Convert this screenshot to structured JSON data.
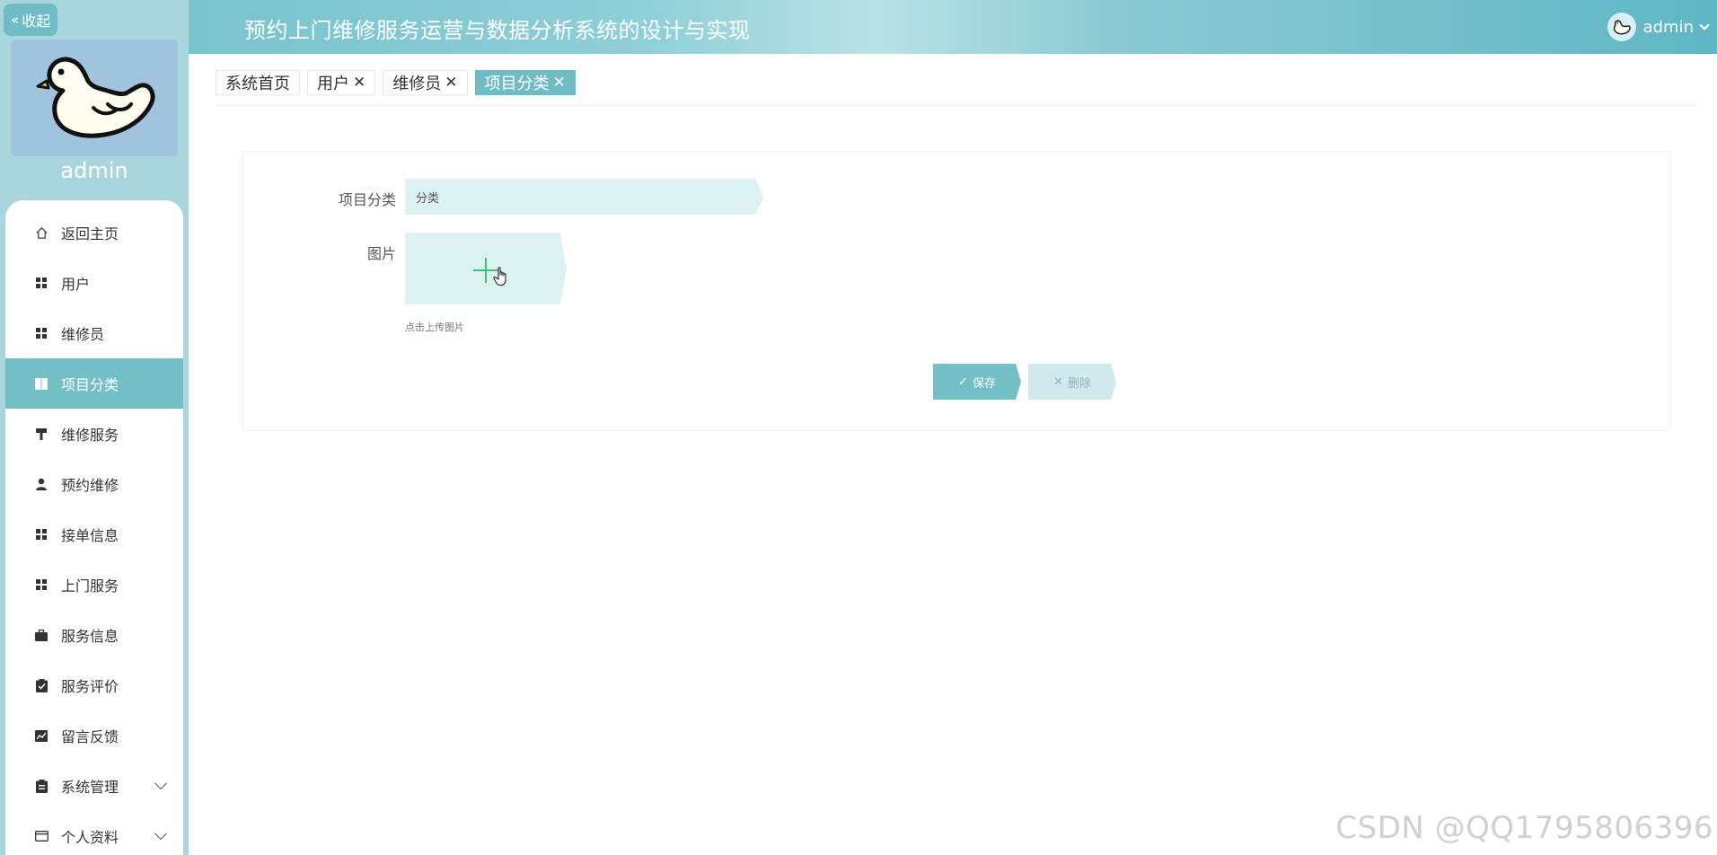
{
  "sidebar": {
    "collapse_label": "收起",
    "username": "admin",
    "items": [
      {
        "label": "返回主页",
        "icon": "home-icon",
        "active": false
      },
      {
        "label": "用户",
        "icon": "grid-icon",
        "active": false
      },
      {
        "label": "维修员",
        "icon": "grid-icon",
        "active": false
      },
      {
        "label": "项目分类",
        "icon": "book-icon",
        "active": true
      },
      {
        "label": "维修服务",
        "icon": "hammer-icon",
        "active": false
      },
      {
        "label": "预约维修",
        "icon": "user-icon",
        "active": false
      },
      {
        "label": "接单信息",
        "icon": "grid-icon",
        "active": false
      },
      {
        "label": "上门服务",
        "icon": "grid-icon",
        "active": false
      },
      {
        "label": "服务信息",
        "icon": "briefcase-icon",
        "active": false
      },
      {
        "label": "服务评价",
        "icon": "clipboard-check-icon",
        "active": false
      },
      {
        "label": "留言反馈",
        "icon": "chart-icon",
        "active": false
      },
      {
        "label": "系统管理",
        "icon": "clipboard-icon",
        "active": false,
        "expandable": true
      },
      {
        "label": "个人资料",
        "icon": "id-card-icon",
        "active": false,
        "expandable": true
      }
    ]
  },
  "header": {
    "title": "预约上门维修服务运营与数据分析系统的设计与实现",
    "user": "admin"
  },
  "tags": [
    {
      "label": "系统首页",
      "closable": false,
      "active": false
    },
    {
      "label": "用户",
      "closable": true,
      "active": false
    },
    {
      "label": "维修员",
      "closable": true,
      "active": false
    },
    {
      "label": "项目分类",
      "closable": true,
      "active": true
    }
  ],
  "form": {
    "category_label": "项目分类",
    "category_value": "分类",
    "image_label": "图片",
    "upload_tip": "点击上传图片",
    "save_label": "保存",
    "delete_label": "删除"
  },
  "watermark": "CSDN @QQ1795806396",
  "colors": {
    "accent": "#73bfc6",
    "sidebar_bg": "#a9d6dc",
    "input_bg": "#dcf1f2",
    "plus_green": "#3cbf6e"
  }
}
